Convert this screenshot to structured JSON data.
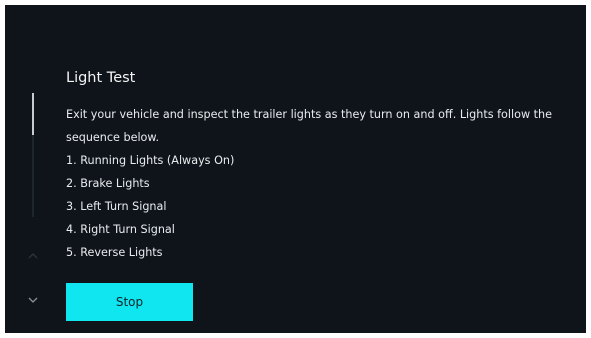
{
  "dialog": {
    "title": "Light Test",
    "description": "Exit your vehicle and inspect the trailer lights as they turn on and off. Lights follow the sequence below.",
    "steps": [
      "1. Running Lights (Always On)",
      "2. Brake Lights",
      "3. Left Turn Signal",
      "4. Right Turn Signal",
      "5. Reverse Lights"
    ],
    "stop_label": "Stop"
  },
  "scroll": {
    "up_icon": "chevron-up-icon",
    "down_icon": "chevron-down-icon"
  },
  "colors": {
    "background": "#0e141a",
    "accent": "#10e6ef",
    "text": "#e9ecef"
  }
}
